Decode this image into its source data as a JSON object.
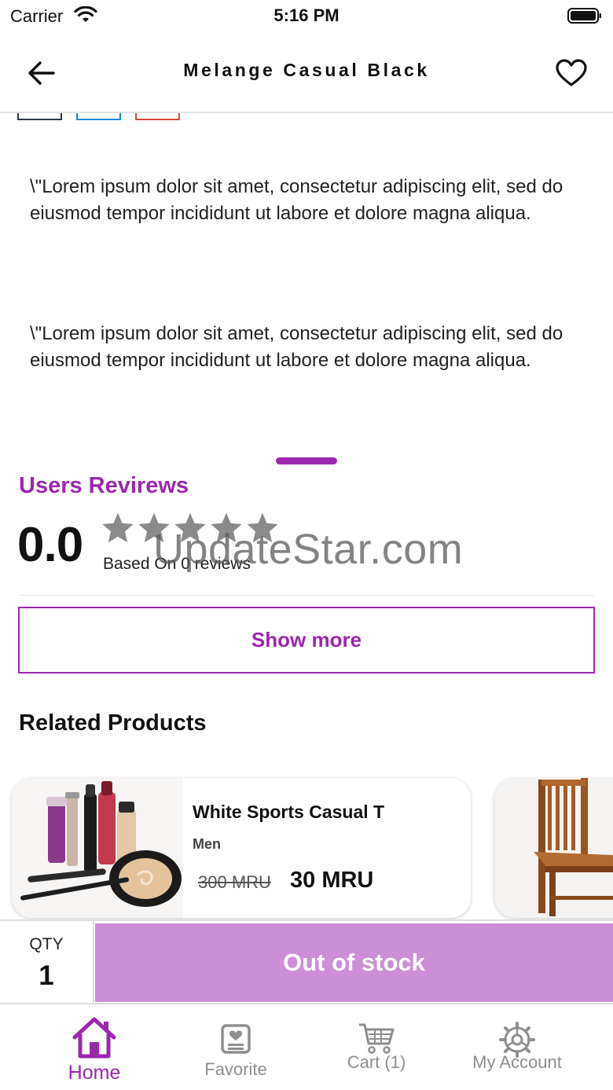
{
  "status_bar": {
    "carrier": "Carrier",
    "time": "5:16 PM"
  },
  "header": {
    "title": "Melange Casual Black",
    "back_icon": "arrow-left-icon",
    "favorite_icon": "heart-outline-icon"
  },
  "color_swatches": [
    {
      "name": "black",
      "color": "#2b3a4a"
    },
    {
      "name": "blue",
      "color": "#1e86d6"
    },
    {
      "name": "red",
      "color": "#d64a3c"
    }
  ],
  "description": {
    "paragraph_1": "\\\"Lorem ipsum dolor sit amet, consectetur adipiscing elit, sed do eiusmod tempor incididunt ut labore et dolore magna aliqua.",
    "paragraph_2": "\\\"Lorem ipsum dolor sit amet, consectetur adipiscing elit, sed do eiusmod tempor incididunt ut labore et dolore magna aliqua."
  },
  "reviews": {
    "title": "Users Revirews",
    "rating": "0.0",
    "rating_value": 0,
    "stars_total": 5,
    "based_on": "Based On 0 reviews",
    "show_more_label": "Show more"
  },
  "watermark": "UpdateStar.com",
  "related": {
    "title": "Related Products",
    "products": [
      {
        "name": "White Sports Casual T",
        "category": "Men",
        "old_price": "300 MRU",
        "price": "30 MRU",
        "image": "cosmetics-image"
      },
      {
        "name": "",
        "image": "wooden-chair-image"
      }
    ]
  },
  "purchase_bar": {
    "qty_label": "QTY",
    "qty_value": "1",
    "cta_label": "Out of stock"
  },
  "tab_bar": {
    "items": [
      {
        "label": "Home",
        "icon": "home-icon",
        "active": true
      },
      {
        "label": "Favorite",
        "icon": "favorite-icon",
        "active": false
      },
      {
        "label": "Cart (1)",
        "icon": "cart-icon",
        "active": false
      },
      {
        "label": "My Account",
        "icon": "settings-gear-icon",
        "active": false
      }
    ]
  },
  "colors": {
    "accent": "#9b27af",
    "cta_disabled": "#cc8ed7",
    "star_empty": "#8a8a8a",
    "tab_inactive": "#8e8e8e"
  }
}
